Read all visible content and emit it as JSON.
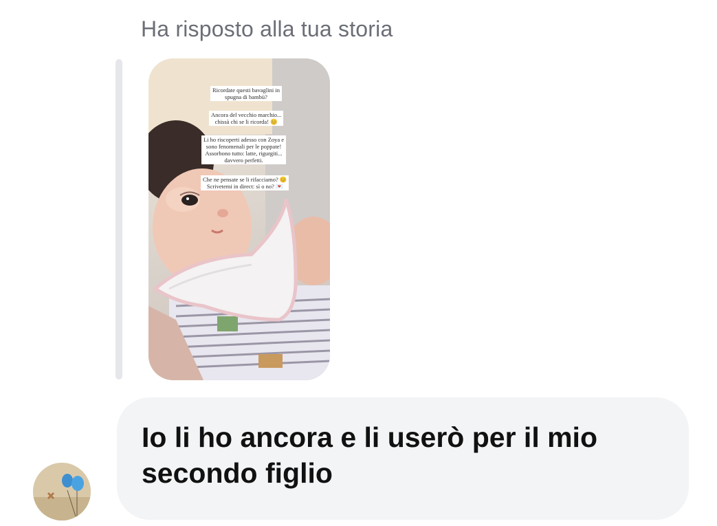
{
  "header": {
    "reply_label": "Ha risposto alla tua storia"
  },
  "story": {
    "captions": [
      "Ricordate questi bavaglini in\nspugna di bambù?",
      "Ancora del vecchio marchio...\nchissà chi se li ricorda! 😊",
      "Li ho riscoperti adesso con Zoya e\nsono fenomenali per le poppate!\nAssorbono tutto: latte, rigurgiti...\ndavvero perfetti.",
      "Che ne pensate se li rifacciamo? 😊\nScrivetemi in direct: sì o no? 💌"
    ]
  },
  "message": {
    "text": "Io li ho ancora e li userò per il mio\nsecondo figlio"
  },
  "colors": {
    "bubble_bg": "#f3f4f6",
    "label_gray": "#6b6e76",
    "quote_bar": "#e6e7ea"
  },
  "icons": {
    "avatar": "avatar-balloons"
  }
}
